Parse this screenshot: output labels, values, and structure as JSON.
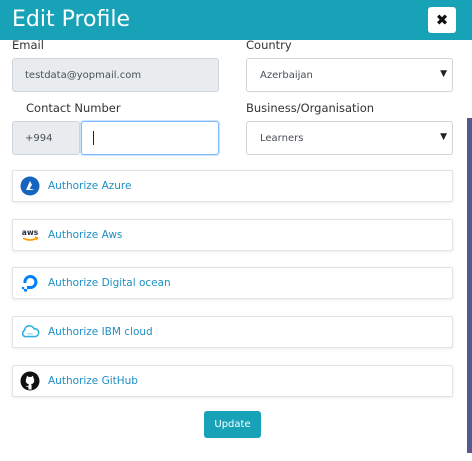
{
  "header": {
    "title": "Edit Profile",
    "close_icon": "close-icon",
    "color": "#17a2b8"
  },
  "form": {
    "email": {
      "label": "Email",
      "value": "testdata@yopmail.com"
    },
    "country": {
      "label": "Country",
      "value": "Azerbaijan"
    },
    "contact": {
      "label": "Contact Number",
      "code": "+994",
      "value": ""
    },
    "business": {
      "label": "Business/Organisation",
      "value": "Learners"
    }
  },
  "integrations": [
    {
      "label": "Authorize Azure",
      "icon": "azure-icon"
    },
    {
      "label": "Authorize Aws",
      "icon": "aws-icon"
    },
    {
      "label": "Authorize Digital ocean",
      "icon": "digital-ocean-icon"
    },
    {
      "label": "Authorize IBM cloud",
      "icon": "ibm-cloud-icon"
    },
    {
      "label": "Authorize GitHub",
      "icon": "github-icon"
    }
  ],
  "actions": {
    "update_label": "Update"
  }
}
